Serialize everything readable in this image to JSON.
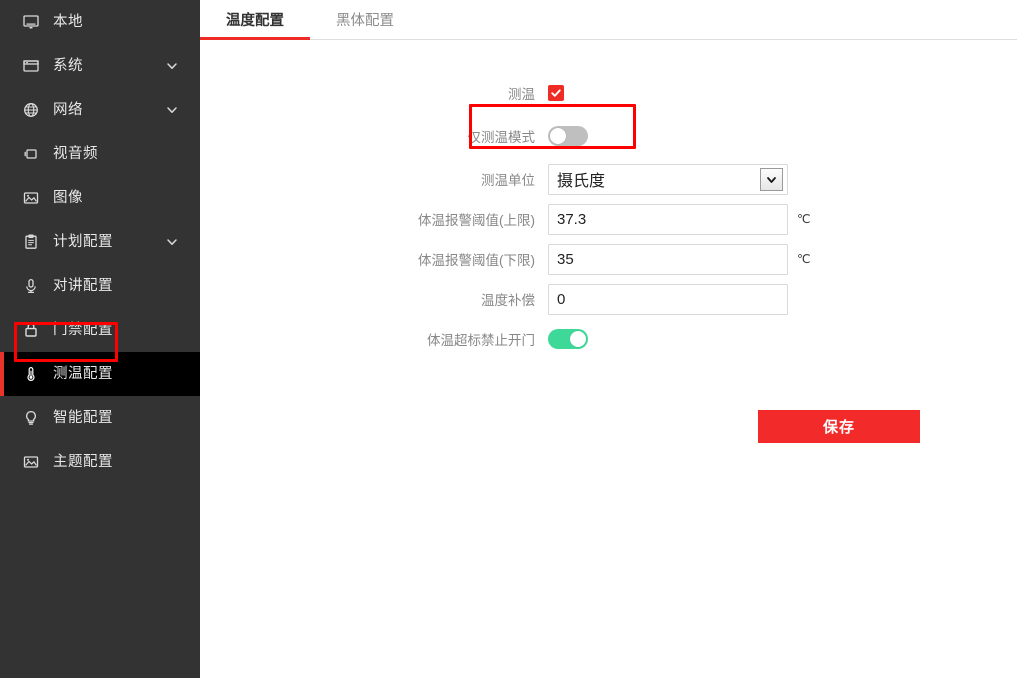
{
  "sidebar": {
    "items": [
      {
        "label": "本地",
        "icon": "monitor-icon",
        "active": false,
        "caret": false
      },
      {
        "label": "系统",
        "icon": "window-icon",
        "active": false,
        "caret": true
      },
      {
        "label": "网络",
        "icon": "globe-icon",
        "active": false,
        "caret": true
      },
      {
        "label": "视音频",
        "icon": "video-audio-icon",
        "active": false,
        "caret": false
      },
      {
        "label": "图像",
        "icon": "image-icon",
        "active": false,
        "caret": false
      },
      {
        "label": "计划配置",
        "icon": "clipboard-icon",
        "active": false,
        "caret": true
      },
      {
        "label": "对讲配置",
        "icon": "microphone-icon",
        "active": false,
        "caret": false
      },
      {
        "label": "门禁配置",
        "icon": "lock-icon",
        "active": false,
        "caret": false
      },
      {
        "label": "测温配置",
        "icon": "thermometer-icon",
        "active": true,
        "caret": false
      },
      {
        "label": "智能配置",
        "icon": "bulb-icon",
        "active": false,
        "caret": false
      },
      {
        "label": "主题配置",
        "icon": "theme-image-icon",
        "active": false,
        "caret": false
      }
    ]
  },
  "tabs": [
    {
      "label": "温度配置",
      "active": true
    },
    {
      "label": "黑体配置",
      "active": false
    }
  ],
  "form": {
    "measure_temp": {
      "label": "测温",
      "checked": true
    },
    "only_temp_mode": {
      "label": "仅测温模式",
      "on": false
    },
    "temp_unit": {
      "label": "测温单位",
      "value": "摄氏度"
    },
    "alarm_upper": {
      "label": "体温报警阈值(上限)",
      "value": "37.3",
      "unit": "℃"
    },
    "alarm_lower": {
      "label": "体温报警阈值(下限)",
      "value": "35",
      "unit": "℃"
    },
    "temp_comp": {
      "label": "温度补偿",
      "value": "0",
      "unit": ""
    },
    "block_door": {
      "label": "体温超标禁止开门",
      "on": true
    },
    "save_label": "保存"
  },
  "colors": {
    "accent_red": "#ee2b24",
    "save_red": "#f32a2a",
    "toggle_on_green": "#3ed998",
    "toggle_off_gray": "#bfbfbf",
    "sidebar_bg": "#333333",
    "active_item_bg": "#000000",
    "annotation_red": "#ff0000"
  }
}
